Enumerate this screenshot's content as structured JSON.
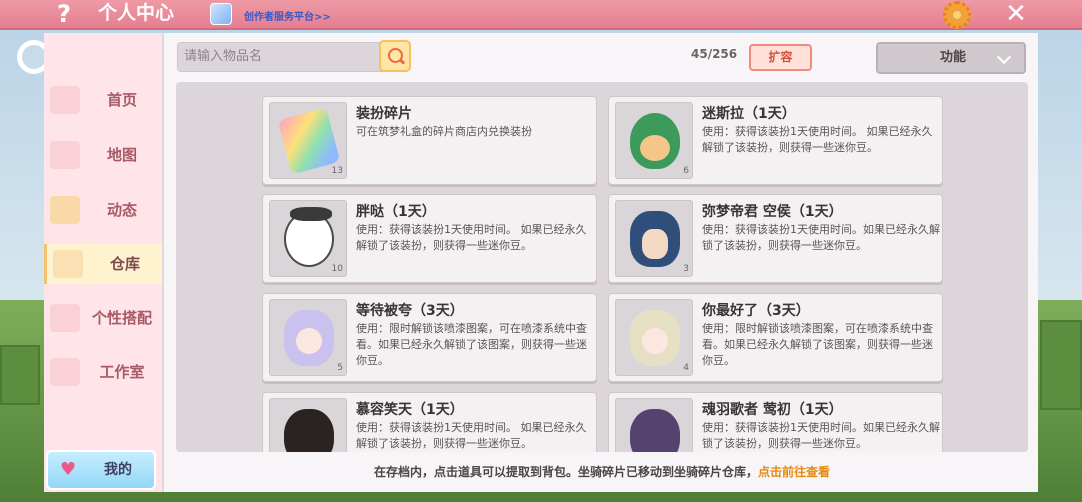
{
  "header": {
    "title": "个人中心",
    "creator_link": "创作者服务平台>>",
    "help_icon": "?",
    "close_icon": "✕"
  },
  "sidebar": {
    "items": [
      {
        "label": "首页",
        "icon": "home-icon"
      },
      {
        "label": "地图",
        "icon": "map-icon"
      },
      {
        "label": "动态",
        "icon": "bell-icon"
      },
      {
        "label": "仓库",
        "icon": "warehouse-icon",
        "active": true
      },
      {
        "label": "个性搭配",
        "icon": "outfit-icon"
      },
      {
        "label": "工作室",
        "icon": "studio-icon"
      }
    ],
    "my_button": "我的"
  },
  "toolbar": {
    "search_placeholder": "请输入物品名",
    "count": "45/256",
    "expand_label": "扩容",
    "function_label": "功能"
  },
  "items": [
    {
      "name": "装扮碎片",
      "desc": "可在筑梦礼盒的碎片商店内兑换装扮",
      "qty": "13"
    },
    {
      "name": "迷斯拉（1天）",
      "desc": "使用：获得该装扮1天使用时间。 如果已经永久解锁了该装扮，则获得一些迷你豆。",
      "qty": "6"
    },
    {
      "name": "胖哒（1天）",
      "desc": "使用：获得该装扮1天使用时间。 如果已经永久解锁了该装扮，则获得一些迷你豆。",
      "qty": "10"
    },
    {
      "name": "弥梦帝君 空侯（1天）",
      "desc": "使用：获得该装扮1天使用时间。如果已经永久解锁了该装扮，则获得一些迷你豆。",
      "qty": "3"
    },
    {
      "name": "等待被夸（3天）",
      "desc": "使用：限时解锁该喷漆图案，可在喷漆系统中查看。如果已经永久解锁了该图案，则获得一些迷你豆。",
      "qty": "5"
    },
    {
      "name": "你最好了（3天）",
      "desc": "使用：限时解锁该喷漆图案，可在喷漆系统中查看。如果已经永久解锁了该图案，则获得一些迷你豆。",
      "qty": "4"
    },
    {
      "name": "慕容笑天（1天）",
      "desc": "使用：获得该装扮1天使用时间。 如果已经永久解锁了该装扮，则获得一些迷你豆。",
      "qty": ""
    },
    {
      "name": "魂羽歌者 莺初（1天）",
      "desc": "使用：获得该装扮1天使用时间。如果已经永久解锁了该装扮，则获得一些迷你豆。",
      "qty": ""
    }
  ],
  "footer": {
    "text": "在存档内，点击道具可以提取到背包。坐骑碎片已移动到坐骑碎片仓库，",
    "link": "点击前往查看"
  }
}
